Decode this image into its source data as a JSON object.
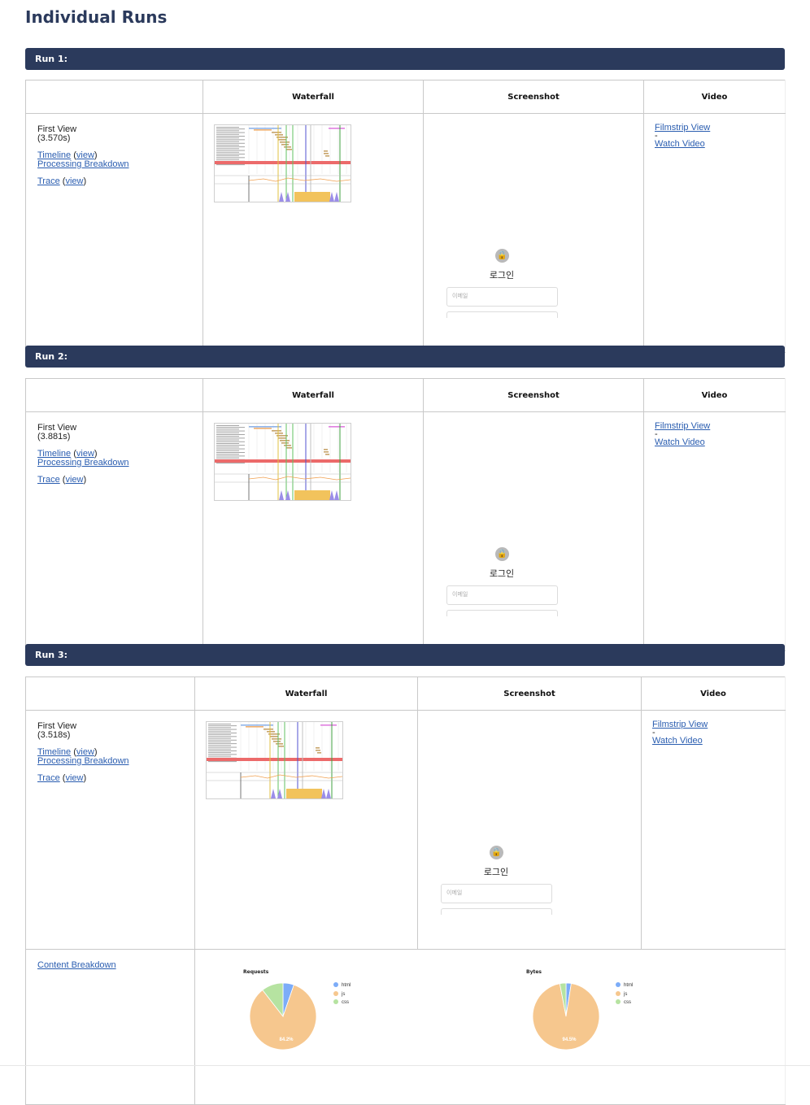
{
  "page": {
    "title": "Individual Runs"
  },
  "columns": {
    "waterfall": "Waterfall",
    "screenshot": "Screenshot",
    "video": "Video"
  },
  "labels": {
    "first_view": "First View",
    "timeline": "Timeline",
    "view": "view",
    "processing_breakdown": "Processing Breakdown",
    "trace": "Trace",
    "filmstrip_view": "Filmstrip View",
    "dash": "-",
    "watch_video": "Watch Video",
    "content_breakdown": "Content Breakdown",
    "screenshot_login": "로그인",
    "screenshot_email_placeholder": "이메일"
  },
  "runs": [
    {
      "header": "Run 1:",
      "first_view_time": "(3.570s)"
    },
    {
      "header": "Run 2:",
      "first_view_time": "(3.881s)"
    },
    {
      "header": "Run 3:",
      "first_view_time": "(3.518s)"
    }
  ],
  "content_breakdown": {
    "legend": [
      "html",
      "js",
      "css"
    ],
    "colors": {
      "html": "#7cacf8",
      "js": "#f6c78e",
      "css": "#b6e3a1"
    },
    "charts": [
      {
        "title": "Requests",
        "label": "84.2%"
      },
      {
        "title": "Bytes",
        "label": "94.5%"
      }
    ]
  },
  "chart_data": [
    {
      "type": "pie",
      "title": "Requests",
      "categories": [
        "html",
        "js",
        "css"
      ],
      "values": [
        5.3,
        84.2,
        10.5
      ],
      "legend": "right"
    },
    {
      "type": "pie",
      "title": "Bytes",
      "categories": [
        "html",
        "js",
        "css"
      ],
      "values": [
        2.5,
        94.5,
        3.0
      ],
      "legend": "right"
    }
  ]
}
